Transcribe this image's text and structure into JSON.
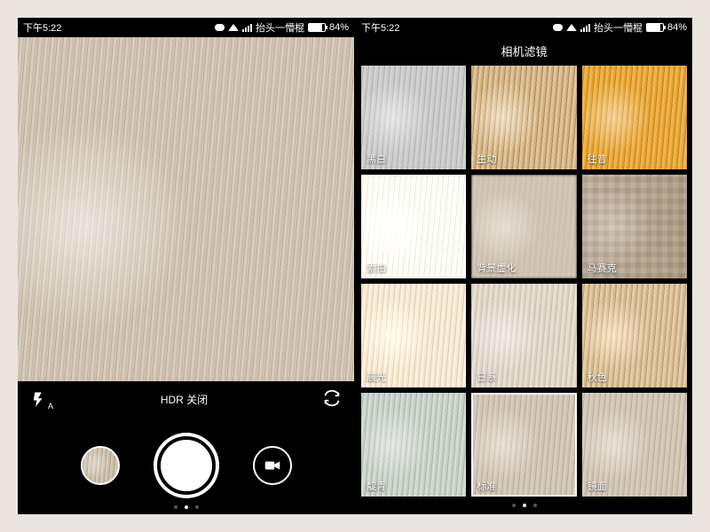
{
  "status": {
    "time": "下午5:22",
    "carrier_text": "抬头一懵棍",
    "battery_pct": "84%"
  },
  "left": {
    "flash_sub": "A",
    "hdr_label": "HDR 关闭",
    "pager_active_index": 1,
    "pager_count": 3
  },
  "right": {
    "title": "相机滤镜",
    "selected_index": 10,
    "pager_active_index": 1,
    "pager_count": 3,
    "filters": [
      "黑白",
      "生动",
      "往昔",
      "素拍",
      "背景虚化",
      "马赛克",
      "晨光",
      "日系",
      "秋色",
      "靛青",
      "标准",
      "镜面"
    ]
  }
}
